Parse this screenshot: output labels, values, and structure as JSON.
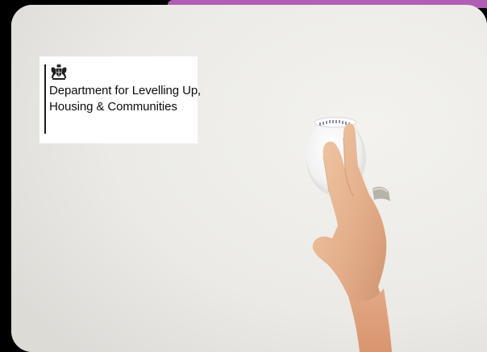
{
  "accent_color": "#b15fb4",
  "logo": {
    "line1": "Department for Levelling Up,",
    "line2": "Housing & Communities",
    "crest_icon": "royal-coat-of-arms-icon"
  },
  "photo": {
    "subject_icon": "smoke-alarm-icon"
  }
}
